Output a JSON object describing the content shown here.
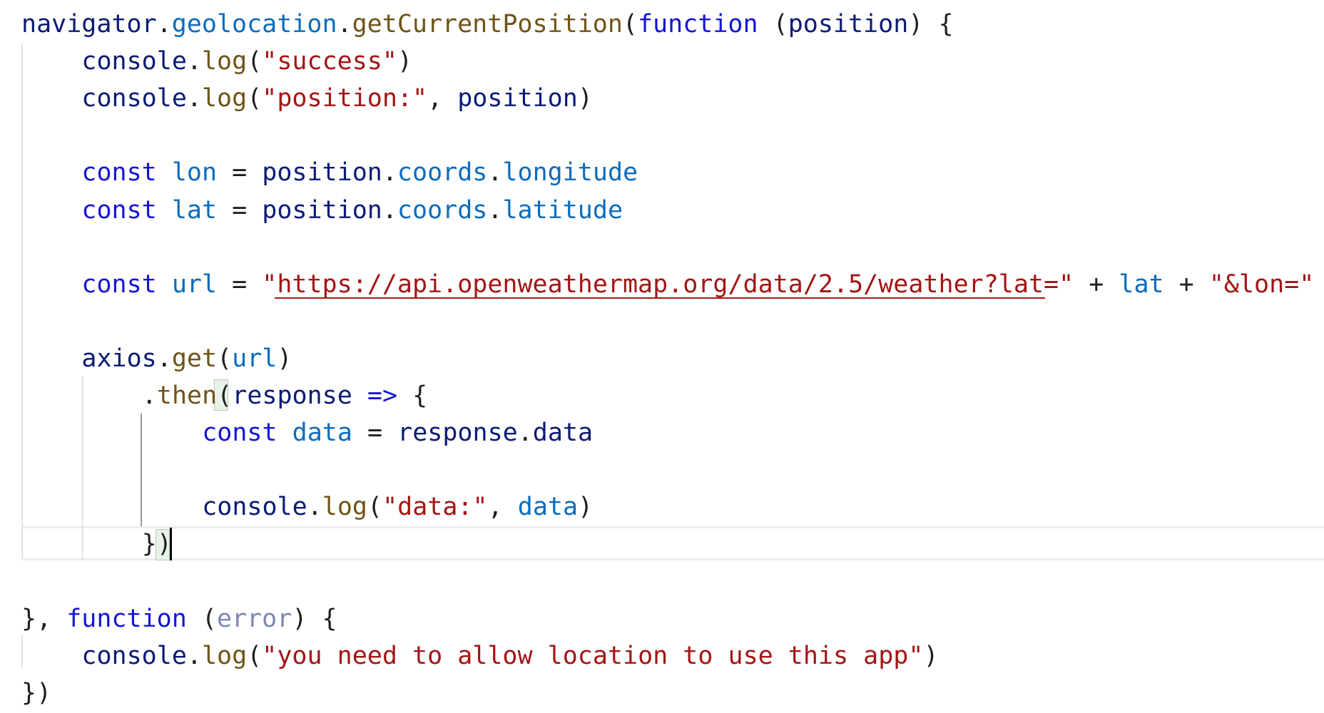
{
  "colors": {
    "plain": "#1f1f1f",
    "variable": "#0c1b73",
    "property": "#0b6cbd",
    "function": "#6e5417",
    "keyword": "#1515d6",
    "string": "#a31515",
    "param_unused": "#7e86b3",
    "background": "#ffffff"
  },
  "code": {
    "lines": [
      {
        "indent": 0,
        "tokens": [
          {
            "t": "navigator",
            "c": "variable"
          },
          {
            "t": ".",
            "c": "plain"
          },
          {
            "t": "geolocation",
            "c": "property"
          },
          {
            "t": ".",
            "c": "plain"
          },
          {
            "t": "getCurrentPosition",
            "c": "function"
          },
          {
            "t": "(",
            "c": "plain"
          },
          {
            "t": "function",
            "c": "keyword"
          },
          {
            "t": " (",
            "c": "plain"
          },
          {
            "t": "position",
            "c": "variable"
          },
          {
            "t": ") {",
            "c": "plain"
          }
        ]
      },
      {
        "indent": 4,
        "tokens": [
          {
            "t": "console",
            "c": "variable"
          },
          {
            "t": ".",
            "c": "plain"
          },
          {
            "t": "log",
            "c": "function"
          },
          {
            "t": "(",
            "c": "plain"
          },
          {
            "t": "\"success\"",
            "c": "string"
          },
          {
            "t": ")",
            "c": "plain"
          }
        ]
      },
      {
        "indent": 4,
        "tokens": [
          {
            "t": "console",
            "c": "variable"
          },
          {
            "t": ".",
            "c": "plain"
          },
          {
            "t": "log",
            "c": "function"
          },
          {
            "t": "(",
            "c": "plain"
          },
          {
            "t": "\"position:\"",
            "c": "string"
          },
          {
            "t": ", ",
            "c": "plain"
          },
          {
            "t": "position",
            "c": "variable"
          },
          {
            "t": ")",
            "c": "plain"
          }
        ]
      },
      {
        "indent": 0,
        "tokens": []
      },
      {
        "indent": 4,
        "tokens": [
          {
            "t": "const",
            "c": "keyword"
          },
          {
            "t": " ",
            "c": "plain"
          },
          {
            "t": "lon",
            "c": "property"
          },
          {
            "t": " = ",
            "c": "plain"
          },
          {
            "t": "position",
            "c": "variable"
          },
          {
            "t": ".",
            "c": "plain"
          },
          {
            "t": "coords",
            "c": "property"
          },
          {
            "t": ".",
            "c": "plain"
          },
          {
            "t": "longitude",
            "c": "property"
          }
        ]
      },
      {
        "indent": 4,
        "tokens": [
          {
            "t": "const",
            "c": "keyword"
          },
          {
            "t": " ",
            "c": "plain"
          },
          {
            "t": "lat",
            "c": "property"
          },
          {
            "t": " = ",
            "c": "plain"
          },
          {
            "t": "position",
            "c": "variable"
          },
          {
            "t": ".",
            "c": "plain"
          },
          {
            "t": "coords",
            "c": "property"
          },
          {
            "t": ".",
            "c": "plain"
          },
          {
            "t": "latitude",
            "c": "property"
          }
        ]
      },
      {
        "indent": 0,
        "tokens": []
      },
      {
        "indent": 4,
        "tokens": [
          {
            "t": "const",
            "c": "keyword"
          },
          {
            "t": " ",
            "c": "plain"
          },
          {
            "t": "url",
            "c": "property"
          },
          {
            "t": " = ",
            "c": "plain"
          },
          {
            "t": "\"https://api.openweathermap.org/data/2.5/weather?lat=\"",
            "c": "string"
          },
          {
            "t": " + ",
            "c": "plain"
          },
          {
            "t": "lat",
            "c": "property"
          },
          {
            "t": " + ",
            "c": "plain"
          },
          {
            "t": "\"&lon=\"",
            "c": "string"
          },
          {
            "t": " +",
            "c": "plain"
          }
        ]
      },
      {
        "indent": 0,
        "tokens": []
      },
      {
        "indent": 4,
        "tokens": [
          {
            "t": "axios",
            "c": "variable"
          },
          {
            "t": ".",
            "c": "plain"
          },
          {
            "t": "get",
            "c": "function"
          },
          {
            "t": "(",
            "c": "plain"
          },
          {
            "t": "url",
            "c": "property"
          },
          {
            "t": ")",
            "c": "plain"
          }
        ]
      },
      {
        "indent": 8,
        "tokens": [
          {
            "t": ".",
            "c": "plain"
          },
          {
            "t": "then",
            "c": "function"
          },
          {
            "t": "(",
            "c": "plain"
          },
          {
            "t": "response",
            "c": "variable"
          },
          {
            "t": " ",
            "c": "plain"
          },
          {
            "t": "=>",
            "c": "keyword"
          },
          {
            "t": " {",
            "c": "plain"
          }
        ]
      },
      {
        "indent": 12,
        "tokens": [
          {
            "t": "const",
            "c": "keyword"
          },
          {
            "t": " ",
            "c": "plain"
          },
          {
            "t": "data",
            "c": "property"
          },
          {
            "t": " = ",
            "c": "plain"
          },
          {
            "t": "response",
            "c": "variable"
          },
          {
            "t": ".",
            "c": "plain"
          },
          {
            "t": "data",
            "c": "variable"
          }
        ]
      },
      {
        "indent": 0,
        "tokens": []
      },
      {
        "indent": 12,
        "tokens": [
          {
            "t": "console",
            "c": "variable"
          },
          {
            "t": ".",
            "c": "plain"
          },
          {
            "t": "log",
            "c": "function"
          },
          {
            "t": "(",
            "c": "plain"
          },
          {
            "t": "\"data:\"",
            "c": "string"
          },
          {
            "t": ", ",
            "c": "plain"
          },
          {
            "t": "data",
            "c": "property"
          },
          {
            "t": ")",
            "c": "plain"
          }
        ]
      },
      {
        "indent": 8,
        "tokens": [
          {
            "t": "})",
            "c": "plain"
          }
        ]
      },
      {
        "indent": 0,
        "tokens": []
      },
      {
        "indent": 0,
        "tokens": [
          {
            "t": "}, ",
            "c": "plain"
          },
          {
            "t": "function",
            "c": "keyword"
          },
          {
            "t": " (",
            "c": "plain"
          },
          {
            "t": "error",
            "c": "param_unused"
          },
          {
            "t": ") {",
            "c": "plain"
          }
        ]
      },
      {
        "indent": 4,
        "tokens": [
          {
            "t": "console",
            "c": "variable"
          },
          {
            "t": ".",
            "c": "plain"
          },
          {
            "t": "log",
            "c": "function"
          },
          {
            "t": "(",
            "c": "plain"
          },
          {
            "t": "\"you need to allow location to use this app\"",
            "c": "string"
          },
          {
            "t": ")",
            "c": "plain"
          }
        ]
      },
      {
        "indent": 0,
        "tokens": [
          {
            "t": "})",
            "c": "plain"
          }
        ]
      }
    ]
  }
}
